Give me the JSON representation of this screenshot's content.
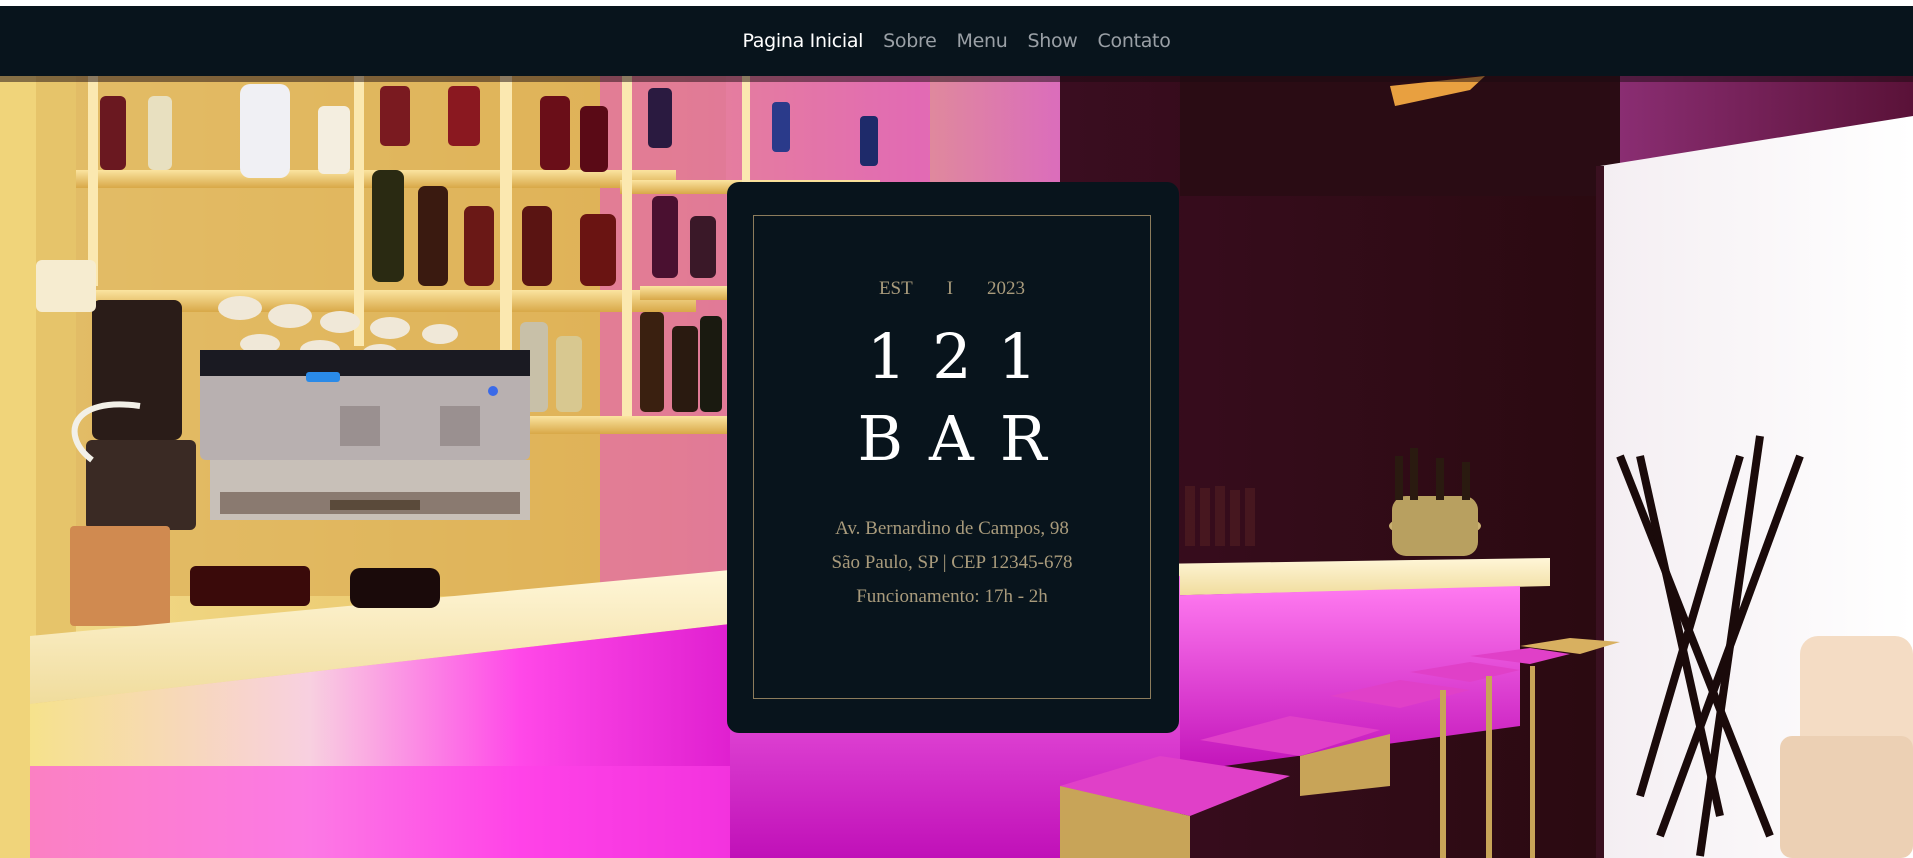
{
  "nav": {
    "items": [
      {
        "label": "Pagina Inicial",
        "active": true
      },
      {
        "label": "Sobre",
        "active": false
      },
      {
        "label": "Menu",
        "active": false
      },
      {
        "label": "Show",
        "active": false
      },
      {
        "label": "Contato",
        "active": false
      }
    ]
  },
  "hero": {
    "image_subject": "bar interior with bottle shelves, espresso machine, illuminated magenta counter and stools",
    "colors": {
      "nav_bg": "#08141c",
      "card_bg": "#08141c",
      "gold_text": "#a99b7c",
      "magenta_light": "#ff33e0",
      "warm_yellow": "#f0d890"
    }
  },
  "card": {
    "est_left": "EST",
    "est_sep": "I",
    "est_year": "2023",
    "brand_line1": "121",
    "brand_line2": "BAR",
    "address_line1": "Av. Bernardino de Campos, 98",
    "address_line2": "São Paulo, SP | CEP 12345-678",
    "hours": "Funcionamento: 17h - 2h"
  }
}
